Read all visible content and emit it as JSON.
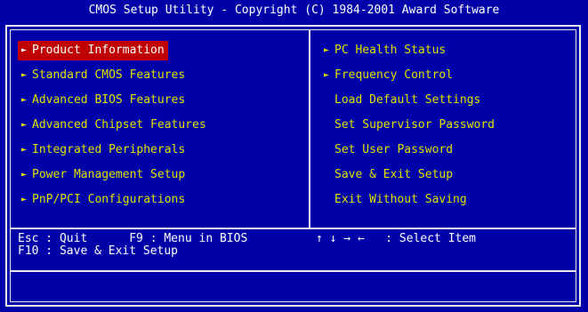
{
  "title": "CMOS Setup Utility - Copyright (C) 1984-2001 Award Software",
  "left_menu": [
    {
      "label": "Product Information",
      "arrow": true,
      "selected": true
    },
    {
      "label": "Standard CMOS Features",
      "arrow": true,
      "selected": false
    },
    {
      "label": "Advanced BIOS Features",
      "arrow": true,
      "selected": false
    },
    {
      "label": "Advanced Chipset Features",
      "arrow": true,
      "selected": false
    },
    {
      "label": "Integrated Peripherals",
      "arrow": true,
      "selected": false
    },
    {
      "label": "Power Management Setup",
      "arrow": true,
      "selected": false
    },
    {
      "label": "PnP/PCI Configurations",
      "arrow": true,
      "selected": false
    }
  ],
  "right_menu": [
    {
      "label": "PC Health Status",
      "arrow": true
    },
    {
      "label": "Frequency Control",
      "arrow": true
    },
    {
      "label": "Load Default Settings",
      "arrow": false
    },
    {
      "label": "Set Supervisor Password",
      "arrow": false
    },
    {
      "label": "Set User Password",
      "arrow": false
    },
    {
      "label": "Save & Exit Setup",
      "arrow": false
    },
    {
      "label": "Exit Without Saving",
      "arrow": false
    }
  ],
  "footer": {
    "line1_left": "Esc : Quit      F9 : Menu in BIOS",
    "line1_right": "↑ ↓ → ←   : Select Item",
    "line2": "F10 : Save & Exit Setup"
  },
  "arrow_glyph": "►",
  "colors": {
    "background": "#0000a8",
    "menu_text": "#e0e000",
    "selection": "#c00000",
    "border": "#e8e8e8"
  }
}
